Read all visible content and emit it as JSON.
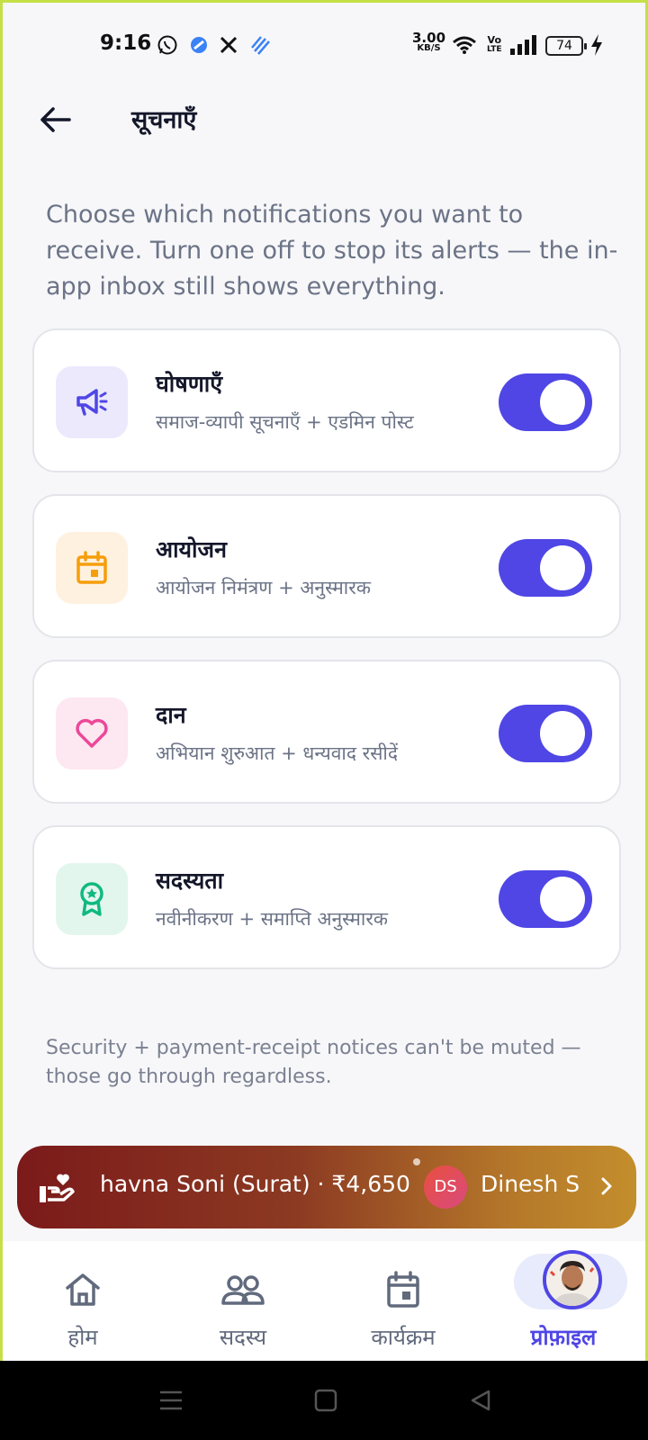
{
  "status": {
    "time": "9:16",
    "net_speed_value": "3.00",
    "net_speed_unit": "KB/S",
    "volte_line1": "Vo",
    "volte_line2": "LTE",
    "battery": "74"
  },
  "header": {
    "title": "सूचनाएँ"
  },
  "intro": "Choose which notifications you want to receive. Turn one off to stop its alerts — the in-app inbox still shows everything.",
  "categories": [
    {
      "title": "घोषणाएँ",
      "subtitle": "समाज-व्यापी सूचनाएँ + एडमिन पोस्ट",
      "icon": "megaphone-icon",
      "icon_bg": "#ece9fd",
      "icon_color": "#4f46e5",
      "enabled": true
    },
    {
      "title": "आयोजन",
      "subtitle": "आयोजन निमंत्रण + अनुस्मारक",
      "icon": "calendar-icon",
      "icon_bg": "#fff1e0",
      "icon_color": "#f59e0b",
      "enabled": true
    },
    {
      "title": "दान",
      "subtitle": "अभियान शुरुआत + धन्यवाद रसीदें",
      "icon": "heart-icon",
      "icon_bg": "#fde7f1",
      "icon_color": "#ec4899",
      "enabled": true
    },
    {
      "title": "सदस्यता",
      "subtitle": "नवीनीकरण + समाप्ति अनुस्मारक",
      "icon": "award-icon",
      "icon_bg": "#e3f6ee",
      "icon_color": "#10b981",
      "enabled": true
    }
  ],
  "footnote": "Security + payment-receipt notices can't be muted — those go through regardless.",
  "ticker": {
    "text": "havna Soni (Surat) · ₹4,650",
    "avatar_initials": "DS",
    "name": "Dinesh S"
  },
  "nav": {
    "items": [
      {
        "label": "होम",
        "icon": "home-icon"
      },
      {
        "label": "सदस्य",
        "icon": "members-icon"
      },
      {
        "label": "कार्यक्रम",
        "icon": "calendar-icon"
      },
      {
        "label": "प्रोफ़ाइल",
        "icon": "profile-avatar"
      }
    ],
    "active": 3
  },
  "colors": {
    "accent": "#4f46e5",
    "background": "#f7f7f9"
  }
}
